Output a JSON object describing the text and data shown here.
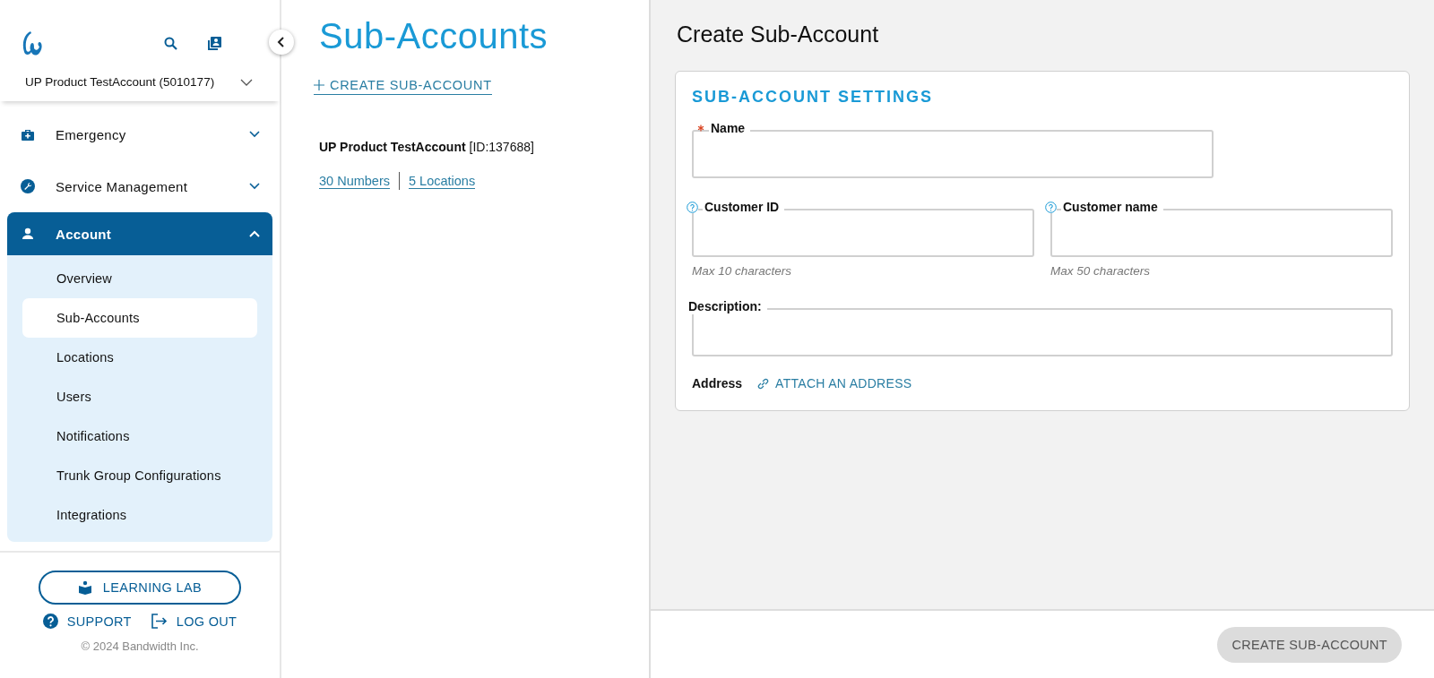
{
  "sidebar": {
    "account_selector": "UP Product TestAccount (5010177)",
    "nav": [
      {
        "label": "Emergency",
        "expanded": false
      },
      {
        "label": "Service Management",
        "expanded": false
      },
      {
        "label": "Account",
        "expanded": true,
        "children": [
          {
            "label": "Overview",
            "selected": false
          },
          {
            "label": "Sub-Accounts",
            "selected": true
          },
          {
            "label": "Locations",
            "selected": false
          },
          {
            "label": "Users",
            "selected": false
          },
          {
            "label": "Notifications",
            "selected": false
          },
          {
            "label": "Trunk Group Configurations",
            "selected": false
          },
          {
            "label": "Integrations",
            "selected": false
          }
        ]
      }
    ],
    "learning_lab": "LEARNING LAB",
    "support": "SUPPORT",
    "logout": "LOG OUT",
    "copyright": "© 2024 Bandwidth Inc."
  },
  "list_panel": {
    "title": "Sub-Accounts",
    "create_link": "CREATE SUB-ACCOUNT",
    "accounts": [
      {
        "name": "UP Product TestAccount",
        "id": "[ID:137688]",
        "numbers": "30 Numbers",
        "locations": "5 Locations"
      }
    ]
  },
  "form": {
    "title": "Create Sub-Account",
    "section": "SUB-ACCOUNT SETTINGS",
    "fields": [
      {
        "label": "Name",
        "required": true,
        "help": false
      },
      {
        "label": "Customer ID",
        "required": false,
        "help": true,
        "hint": "Max 10 characters"
      },
      {
        "label": "Customer name",
        "required": false,
        "help": true,
        "hint": "Max 50 characters"
      },
      {
        "label": "Description:",
        "required": false,
        "help": false
      }
    ],
    "address_label": "Address",
    "attach_link": "ATTACH AN ADDRESS",
    "submit": {
      "label": "CREATE SUB-ACCOUNT",
      "disabled": true
    }
  }
}
